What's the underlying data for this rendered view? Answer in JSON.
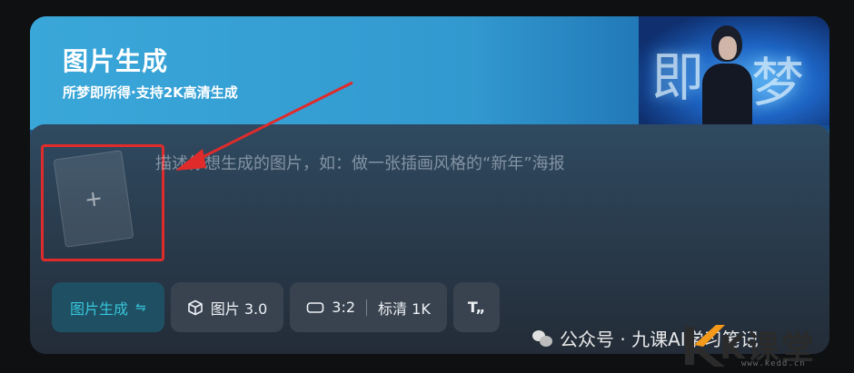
{
  "header": {
    "title": "图片生成",
    "subtitle": "所梦即所得·支持2K高清生成",
    "art_chars": [
      "即",
      "梦"
    ]
  },
  "composer": {
    "upload_symbol": "+",
    "placeholder": "描述你想生成的图片，如：做一张插画风格的“新年”海报"
  },
  "toolbar": {
    "mode_label": "图片生成",
    "mode_icon": "⇋",
    "model_label": "图片 3.0",
    "ratio_label": "3:2",
    "quality_label": "标清 1K",
    "text_icon_label": "T„"
  },
  "watermark": {
    "text": "公众号 · 九课AI学习笔记",
    "logo_text": "K课堂",
    "logo_url": "www.kedd.cn"
  },
  "colors": {
    "accent": "#37c7db",
    "annotation": "#e02b2b"
  }
}
